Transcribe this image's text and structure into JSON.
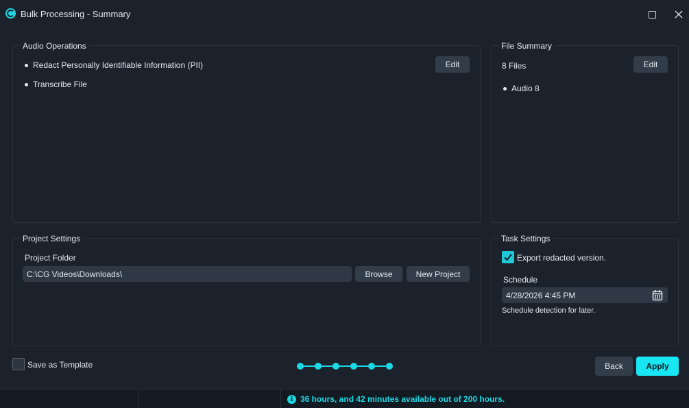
{
  "window": {
    "title": "Bulk Processing - Summary"
  },
  "audio_operations": {
    "title": "Audio Operations",
    "items": [
      "Redact Personally Identifiable Information (PII)",
      "Transcribe File"
    ],
    "edit_label": "Edit"
  },
  "file_summary": {
    "title": "File Summary",
    "count_text": "8 Files",
    "items": [
      "Audio 8"
    ],
    "edit_label": "Edit"
  },
  "project_settings": {
    "title": "Project Settings",
    "folder_label": "Project Folder",
    "folder_value": "C:\\CG Videos\\Downloads\\",
    "browse_label": "Browse",
    "new_project_label": "New Project"
  },
  "task_settings": {
    "title": "Task Settings",
    "export_label": "Export redacted version.",
    "export_checked": true,
    "schedule_label": "Schedule",
    "schedule_value": "4/28/2026 4:45 PM",
    "schedule_hint": "Schedule detection for later."
  },
  "footer": {
    "save_template_label": "Save as Template",
    "save_template_checked": false,
    "back_label": "Back",
    "apply_label": "Apply",
    "steps_total": 6,
    "steps_completed": 6
  },
  "status": {
    "info_text": "36 hours, and 42 minutes available out of 200 hours."
  },
  "colors": {
    "accent": "#18e6f2",
    "background": "#1b222b"
  }
}
